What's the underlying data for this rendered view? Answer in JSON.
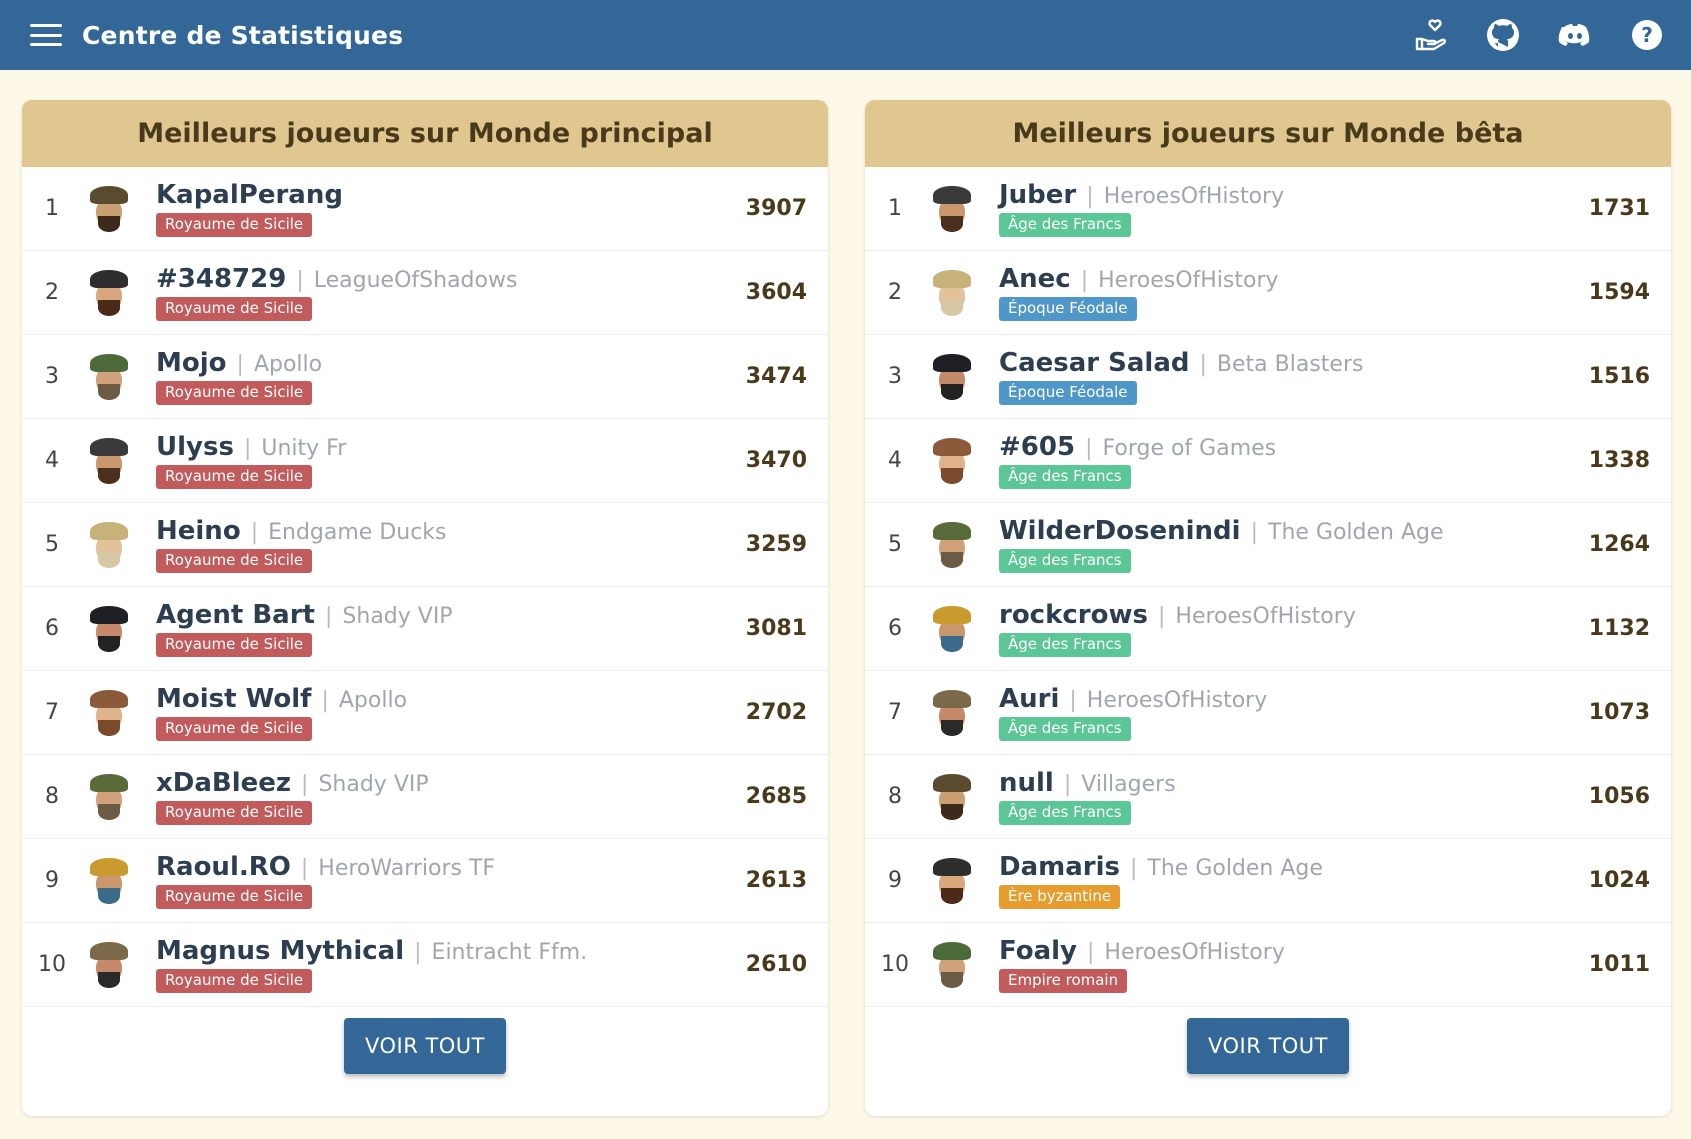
{
  "app": {
    "title": "Centre de Statistiques",
    "icons": [
      "menu-icon",
      "donate-hand-heart-icon",
      "github-icon",
      "discord-icon",
      "help-icon"
    ]
  },
  "colors": {
    "topbar": "#326797",
    "panel_header": "#dfc78f",
    "button": "#326797",
    "era_royaume_de_sicile": "#c25b5b",
    "era_age_des_francs": "#5cc796",
    "era_epoque_feodale": "#4f96c9",
    "era_ere_byzantine": "#e79c2e",
    "era_empire_romain": "#c25b5b"
  },
  "panels": [
    {
      "title": "Meilleurs joueurs sur Monde principal",
      "button_label": "VOIR TOUT",
      "players": [
        {
          "rank": "1",
          "name": "KapalPerang",
          "guild": "",
          "era": "Royaume de Sicile",
          "era_color": "red",
          "score": "3907"
        },
        {
          "rank": "2",
          "name": "#348729",
          "guild": "LeagueOfShadows",
          "era": "Royaume de Sicile",
          "era_color": "red",
          "score": "3604"
        },
        {
          "rank": "3",
          "name": "Mojo",
          "guild": "Apollo",
          "era": "Royaume de Sicile",
          "era_color": "red",
          "score": "3474"
        },
        {
          "rank": "4",
          "name": "Ulyss",
          "guild": "Unity Fr",
          "era": "Royaume de Sicile",
          "era_color": "red",
          "score": "3470"
        },
        {
          "rank": "5",
          "name": "Heino",
          "guild": "Endgame Ducks",
          "era": "Royaume de Sicile",
          "era_color": "red",
          "score": "3259"
        },
        {
          "rank": "6",
          "name": "Agent Bart",
          "guild": "Shady VIP",
          "era": "Royaume de Sicile",
          "era_color": "red",
          "score": "3081"
        },
        {
          "rank": "7",
          "name": "Moist Wolf",
          "guild": "Apollo",
          "era": "Royaume de Sicile",
          "era_color": "red",
          "score": "2702"
        },
        {
          "rank": "8",
          "name": "xDaBleez",
          "guild": "Shady VIP",
          "era": "Royaume de Sicile",
          "era_color": "red",
          "score": "2685"
        },
        {
          "rank": "9",
          "name": "Raoul.RO",
          "guild": "HeroWarriors TF",
          "era": "Royaume de Sicile",
          "era_color": "red",
          "score": "2613"
        },
        {
          "rank": "10",
          "name": "Magnus Mythical",
          "guild": "Eintracht Ffm.",
          "era": "Royaume de Sicile",
          "era_color": "red",
          "score": "2610"
        }
      ]
    },
    {
      "title": "Meilleurs joueurs sur Monde bêta",
      "button_label": "VOIR TOUT",
      "players": [
        {
          "rank": "1",
          "name": "Juber",
          "guild": "HeroesOfHistory",
          "era": "Âge des Francs",
          "era_color": "green",
          "score": "1731"
        },
        {
          "rank": "2",
          "name": "Anec",
          "guild": "HeroesOfHistory",
          "era": "Époque Féodale",
          "era_color": "blue",
          "score": "1594"
        },
        {
          "rank": "3",
          "name": "Caesar Salad",
          "guild": "Beta Blasters",
          "era": "Époque Féodale",
          "era_color": "blue",
          "score": "1516"
        },
        {
          "rank": "4",
          "name": "#605",
          "guild": "Forge of Games",
          "era": "Âge des Francs",
          "era_color": "green",
          "score": "1338"
        },
        {
          "rank": "5",
          "name": "WilderDosenindi",
          "guild": "The Golden Age",
          "era": "Âge des Francs",
          "era_color": "green",
          "score": "1264"
        },
        {
          "rank": "6",
          "name": "rockcrows",
          "guild": "HeroesOfHistory",
          "era": "Âge des Francs",
          "era_color": "green",
          "score": "1132"
        },
        {
          "rank": "7",
          "name": "Auri",
          "guild": "HeroesOfHistory",
          "era": "Âge des Francs",
          "era_color": "green",
          "score": "1073"
        },
        {
          "rank": "8",
          "name": "null",
          "guild": "Villagers",
          "era": "Âge des Francs",
          "era_color": "green",
          "score": "1056"
        },
        {
          "rank": "9",
          "name": "Damaris",
          "guild": "The Golden Age",
          "era": "Ère byzantine",
          "era_color": "orange",
          "score": "1024"
        },
        {
          "rank": "10",
          "name": "Foaly",
          "guild": "HeroesOfHistory",
          "era": "Empire romain",
          "era_color": "red",
          "score": "1011"
        }
      ]
    }
  ]
}
